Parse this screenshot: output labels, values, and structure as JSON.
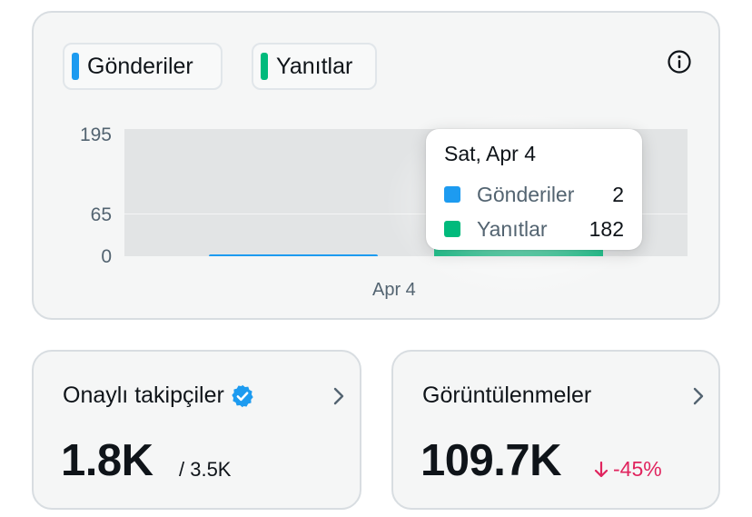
{
  "legend": [
    {
      "label": "Gönderiler",
      "color": "#1d9bf0"
    },
    {
      "label": "Yanıtlar",
      "color": "#00ba7c"
    }
  ],
  "icons": {
    "info": "info-circle-icon",
    "verified": "verified-badge-icon",
    "chevron": "chevron-right-icon",
    "down_arrow": "arrow-down-icon"
  },
  "chart_data": {
    "type": "bar",
    "categories": [
      "Apr 4"
    ],
    "x_tick_label": "Apr 4",
    "y_ticks": [
      "195",
      "65",
      "0"
    ],
    "ylim": [
      0,
      195
    ],
    "grid": true,
    "series": [
      {
        "name": "Gönderiler",
        "values": [
          2
        ],
        "color": "#1d9bf0"
      },
      {
        "name": "Yanıtlar",
        "values": [
          182
        ],
        "color": "#00ba7c"
      }
    ]
  },
  "tooltip": {
    "title": "Sat, Apr 4",
    "rows": [
      {
        "label": "Gönderiler",
        "value": "2",
        "color": "#1d9bf0"
      },
      {
        "label": "Yanıtlar",
        "value": "182",
        "color": "#00ba7c"
      }
    ]
  },
  "followers": {
    "title": "Onaylı takipçiler",
    "value": "1.8K",
    "total": "/ 3.5K"
  },
  "views": {
    "title": "Görüntülenmeler",
    "value": "109.7K",
    "change": "-45%",
    "change_color": "#e0245e"
  }
}
